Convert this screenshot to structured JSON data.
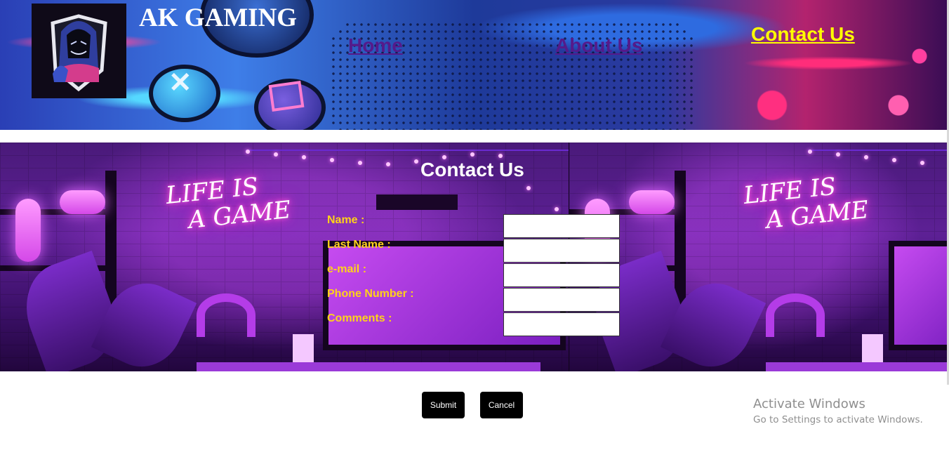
{
  "header": {
    "site_title": "AK GAMING",
    "logo_icon": "hooded-gamer-logo-icon"
  },
  "nav": {
    "items": [
      {
        "label": "Home",
        "color": "#551a8b"
      },
      {
        "label": "About Us",
        "color": "#551a8b"
      },
      {
        "label": "Contact Us",
        "color": "#ffff00",
        "active": true
      }
    ]
  },
  "background": {
    "neon_sign": [
      "LIFE IS",
      "A GAME"
    ]
  },
  "form": {
    "title": "Contact Us",
    "label_color": "#ffd21a",
    "fields": [
      {
        "label": "Name :",
        "value": ""
      },
      {
        "label": "Last Name :",
        "value": ""
      },
      {
        "label": "e-mail :",
        "value": ""
      },
      {
        "label": "Phone Number :",
        "value": ""
      },
      {
        "label": "Comments :",
        "value": ""
      }
    ],
    "buttons": {
      "submit": "Submit",
      "cancel": "Cancel"
    }
  },
  "watermark": {
    "line1": "Activate Windows",
    "line2": "Go to Settings to activate Windows."
  }
}
